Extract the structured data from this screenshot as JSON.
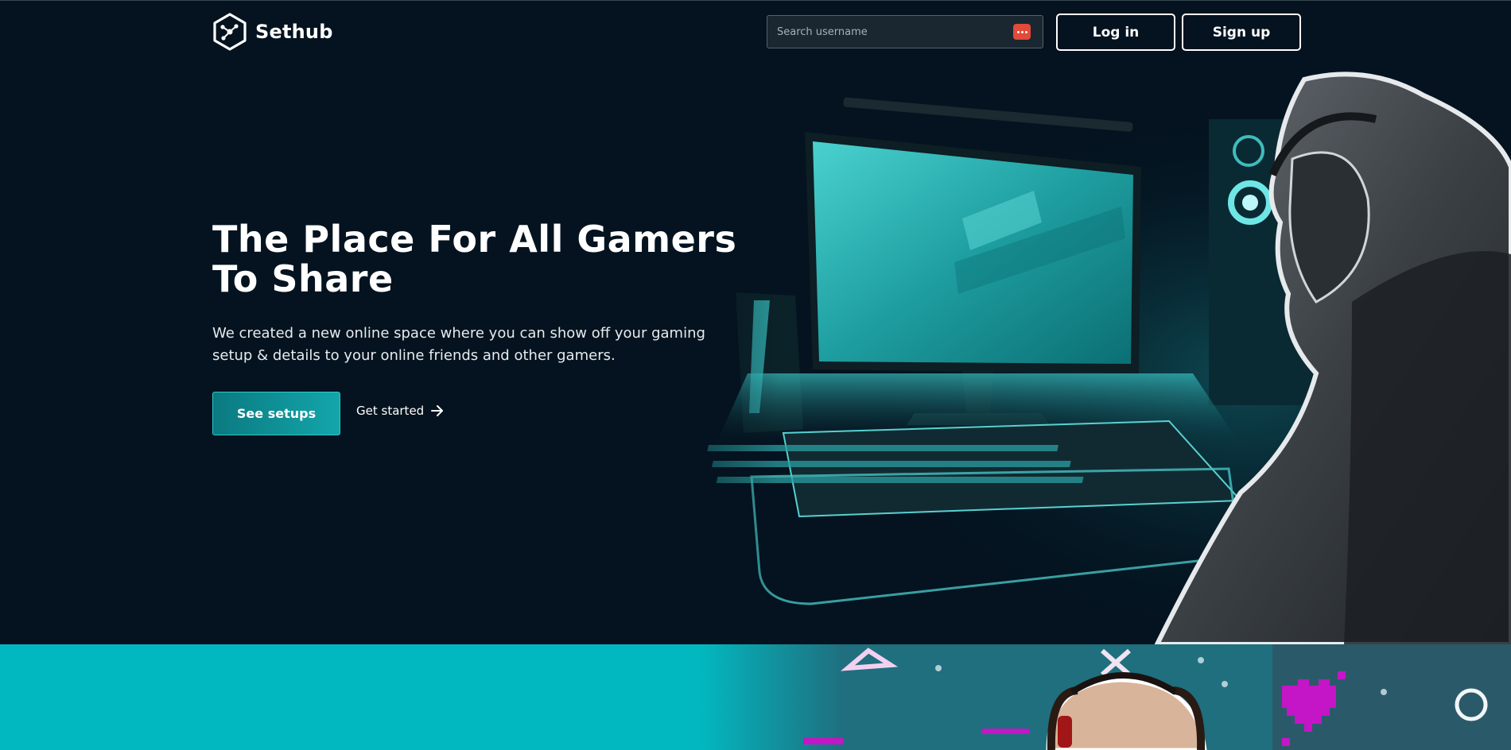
{
  "brand": {
    "name": "Sethub"
  },
  "search": {
    "placeholder": "Search username"
  },
  "nav": {
    "login_label": "Log in",
    "signup_label": "Sign up"
  },
  "hero": {
    "headline": "The Place For All Gamers To Share",
    "subtext": "We created a new online space where you can show off your gaming setup & details to your online friends and other gamers.",
    "primary_cta": "See setups",
    "secondary_cta": "Get started"
  },
  "icons": {
    "logo": "cube-network-icon",
    "search_extension": "password-manager-icon",
    "secondary_cta": "arrow-right-icon"
  },
  "colors": {
    "background": "#04131f",
    "accent_teal": "#13a6ab",
    "section_teal": "#02b8c0",
    "text": "#ffffff"
  }
}
